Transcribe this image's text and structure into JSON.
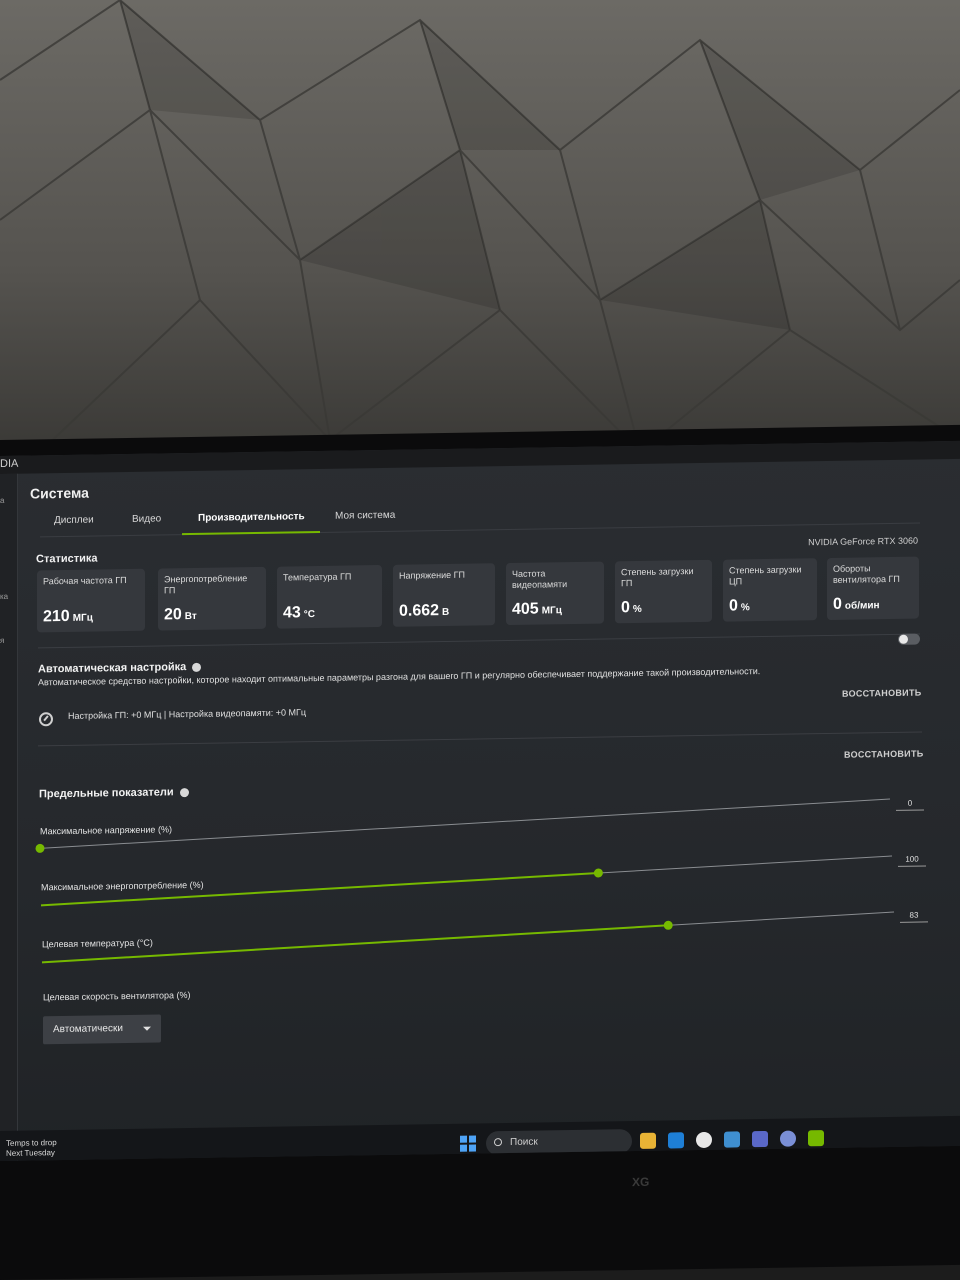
{
  "app": {
    "brand": "DIA"
  },
  "left_rail": [
    "a",
    "ка",
    "я"
  ],
  "page": {
    "title": "Система"
  },
  "tabs": [
    "Дисплеи",
    "Видео",
    "Производительность",
    "Моя система"
  ],
  "active_tab": "Производительность",
  "statistics": {
    "title": "Статистика",
    "gpu_name": "NVIDIA GeForce RTX 3060",
    "cards": [
      {
        "label": "Рабочая частота ГП",
        "value": "210",
        "unit": "МГц"
      },
      {
        "label": "Энергопотребление ГП",
        "value": "20",
        "unit": "Вт"
      },
      {
        "label": "Температура ГП",
        "value": "43",
        "unit": "°C"
      },
      {
        "label": "Напряжение ГП",
        "value": "0.662",
        "unit": "В"
      },
      {
        "label": "Частота видеопамяти",
        "value": "405",
        "unit": "МГц"
      },
      {
        "label": "Степень загрузки ГП",
        "value": "0",
        "unit": "%"
      },
      {
        "label": "Степень загрузки ЦП",
        "value": "0",
        "unit": "%"
      },
      {
        "label": "Обороты вентилятора ГП",
        "value": "0",
        "unit": "об/мин"
      }
    ]
  },
  "auto_tuning": {
    "title": "Автоматическая настройка",
    "description": "Автоматическое средство настройки, которое находит оптимальные параметры разгона для вашего ГП и регулярно обеспечивает поддержание такой производительности.",
    "enabled": false,
    "restore_label": "ВОССТАНОВИТЬ",
    "status": "Настройка ГП: +0 МГц  |  Настройка видеопамяти: +0 МГц"
  },
  "limits": {
    "title": "Предельные показатели",
    "restore_label": "ВОССТАНОВИТЬ",
    "sliders": [
      {
        "label": "Максимальное напряжение (%)",
        "value": "0",
        "fraction": 0.0
      },
      {
        "label": "Максимальное энергопотребление (%)",
        "value": "100",
        "fraction": 0.655
      },
      {
        "label": "Целевая температура (°C)",
        "value": "83",
        "fraction": 0.735
      }
    ],
    "fan_speed": {
      "label": "Целевая скорость вентилятора (%)",
      "selected": "Автоматически"
    }
  },
  "taskbar": {
    "weather_line1": "Temps to drop",
    "weather_line2": "Next Tuesday",
    "search_placeholder": "Поиск"
  },
  "colors": {
    "accent": "#76b900",
    "card": "#35383d",
    "background": "#25282c"
  }
}
